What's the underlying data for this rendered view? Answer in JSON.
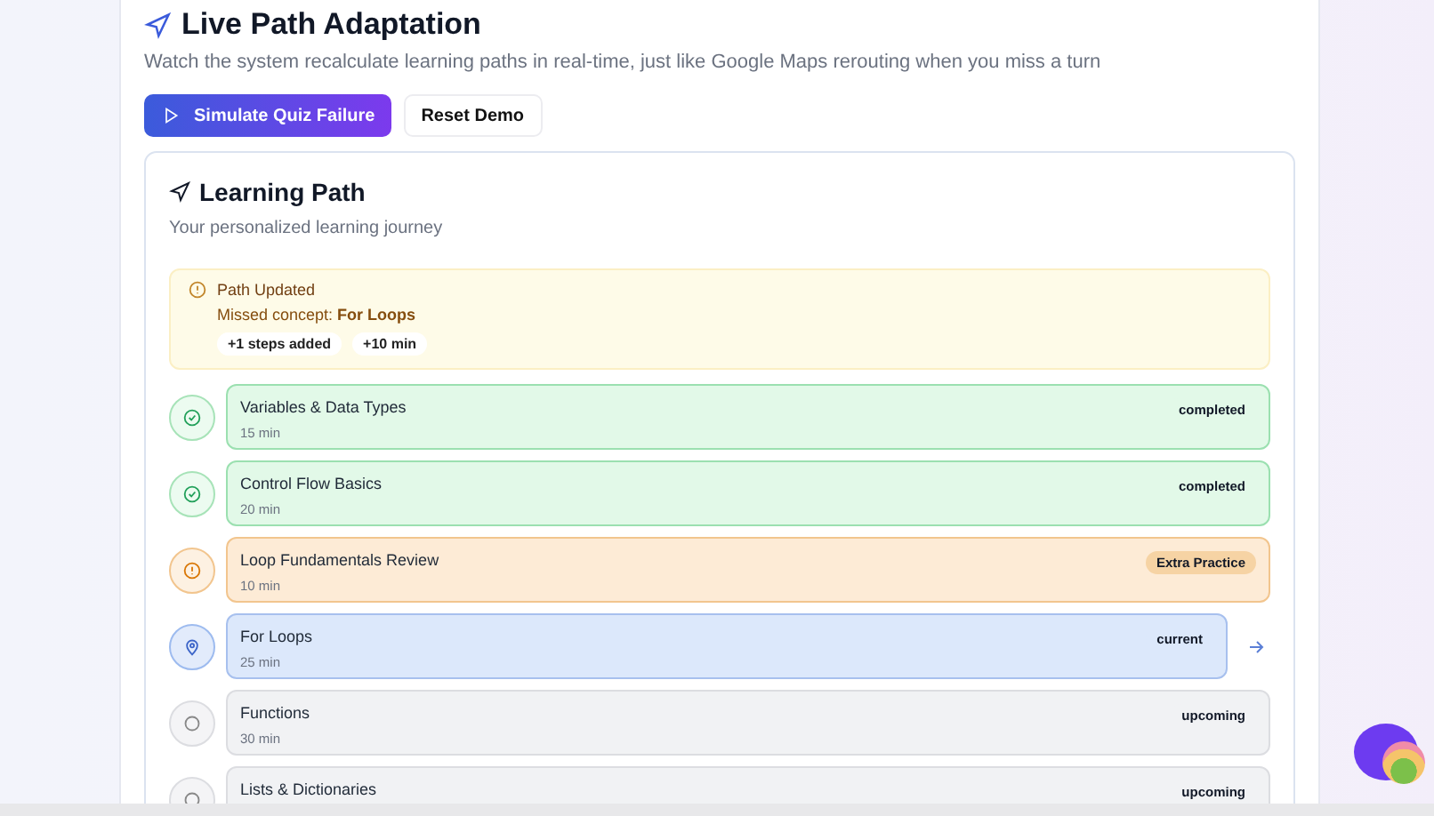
{
  "header": {
    "title": "Live Path Adaptation",
    "description": "Watch the system recalculate learning paths in real-time, just like Google Maps rerouting when you miss a turn"
  },
  "buttons": [
    {
      "label": "Simulate Quiz Failure",
      "kind": "primary"
    },
    {
      "label": "Reset Demo",
      "kind": "secondary"
    }
  ],
  "learning_path": {
    "title": "Learning Path",
    "subtitle": "Your personalized learning journey",
    "alert": {
      "title": "Path Updated",
      "message": "Missed concept: **For Loops**",
      "tags": [
        "+1 steps added",
        "+10 min"
      ]
    },
    "steps": [
      {
        "title": "Variables & Data Types",
        "duration": "15 min",
        "status": "completed",
        "kind": "completed"
      },
      {
        "title": "Control Flow Basics",
        "duration": "20 min",
        "status": "completed",
        "kind": "completed"
      },
      {
        "title": "Loop Fundamentals Review",
        "duration": "10 min",
        "status": "Extra Practice",
        "kind": "extra"
      },
      {
        "title": "For Loops",
        "duration": "25 min",
        "status": "current",
        "kind": "current"
      },
      {
        "title": "Functions",
        "duration": "30 min",
        "status": "upcoming",
        "kind": "upcoming"
      },
      {
        "title": "Lists & Dictionaries",
        "status": "upcoming",
        "kind": "upcoming"
      }
    ]
  }
}
